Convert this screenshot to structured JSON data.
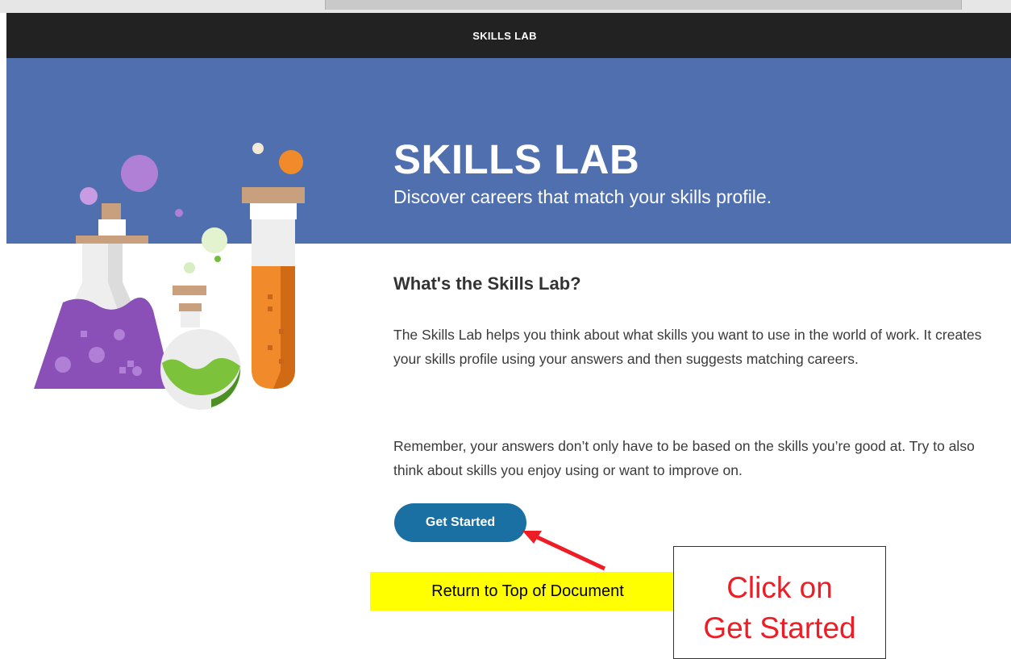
{
  "navbar": {
    "title": "SKILLS LAB"
  },
  "hero": {
    "title": "SKILLS LAB",
    "subtitle": "Discover careers that match your skills profile."
  },
  "section": {
    "heading": "What's the Skills Lab?",
    "paragraphs": [
      "The Skills Lab helps you think about what skills you want to use in the world of work. It creates your skills profile using your answers and then suggests matching careers.",
      "Remember, your answers don’t only have to be based on the skills you’re good at. Try to also think about skills you enjoy using or want to improve on."
    ]
  },
  "button": {
    "label": "Get Started"
  },
  "annotation": {
    "yellow_label": "Return to Top of Document",
    "callout_line1": "Click on",
    "callout_line2": "Get Started",
    "arrow_color": "#ee1c24",
    "highlight_color": "#ffff00"
  },
  "colors": {
    "navbar": "#222222",
    "hero": "#4f6fae",
    "button": "#1a6fa3"
  },
  "icons": [
    "lab-flasks-illustration",
    "red-arrow-icon"
  ]
}
